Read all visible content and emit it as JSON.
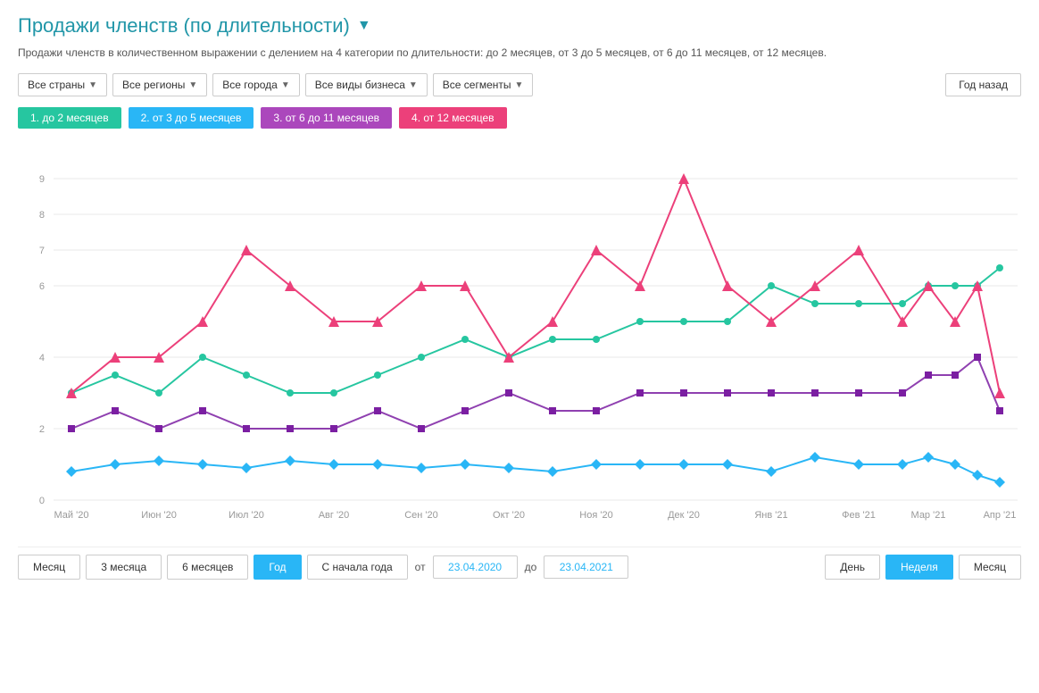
{
  "title": "Продажи членств (по длительности)",
  "subtitle": "Продажи членств в количественном выражении с делением на 4 категории по длительности: до 2 месяцев, от 3 до 5 месяцев, от 6 до 11 месяцев, от 12 месяцев.",
  "filters": [
    {
      "label": "Все страны",
      "id": "countries"
    },
    {
      "label": "Все регионы",
      "id": "regions"
    },
    {
      "label": "Все города",
      "id": "cities"
    },
    {
      "label": "Все виды бизнеса",
      "id": "business"
    },
    {
      "label": "Все сегменты",
      "id": "segments"
    }
  ],
  "period_btn": "Год назад",
  "legend": [
    {
      "label": "1. до 2 месяцев",
      "class": "legend-1"
    },
    {
      "label": "2. от 3 до 5 месяцев",
      "class": "legend-2"
    },
    {
      "label": "3. от 6 до 11 месяцев",
      "class": "legend-3"
    },
    {
      "label": "4. от 12 месяцев",
      "class": "legend-4"
    }
  ],
  "x_labels": [
    "Май '20",
    "Июн '20",
    "Июл '20",
    "Авг '20",
    "Сен '20",
    "Окт '20",
    "Ноя '20",
    "Дек '20",
    "Янв '21",
    "Фев '21",
    "Мар '21",
    "Апр '21"
  ],
  "y_labels": [
    "0",
    "",
    "2",
    "",
    "",
    "",
    "",
    "4",
    "",
    "",
    "",
    "",
    "",
    "6",
    "",
    "",
    "",
    "",
    "8",
    "",
    "",
    "",
    "",
    "9"
  ],
  "bottom_controls": {
    "buttons": [
      "Месяц",
      "3 месяца",
      "6 месяцев",
      "Год",
      "С начала года"
    ],
    "active": "Год",
    "from_label": "от",
    "to_label": "до",
    "from_date": "23.04.2020",
    "to_date": "23.04.2021",
    "right_buttons": [
      "День",
      "Неделя",
      "Месяц"
    ],
    "active_right": "Неделя"
  }
}
